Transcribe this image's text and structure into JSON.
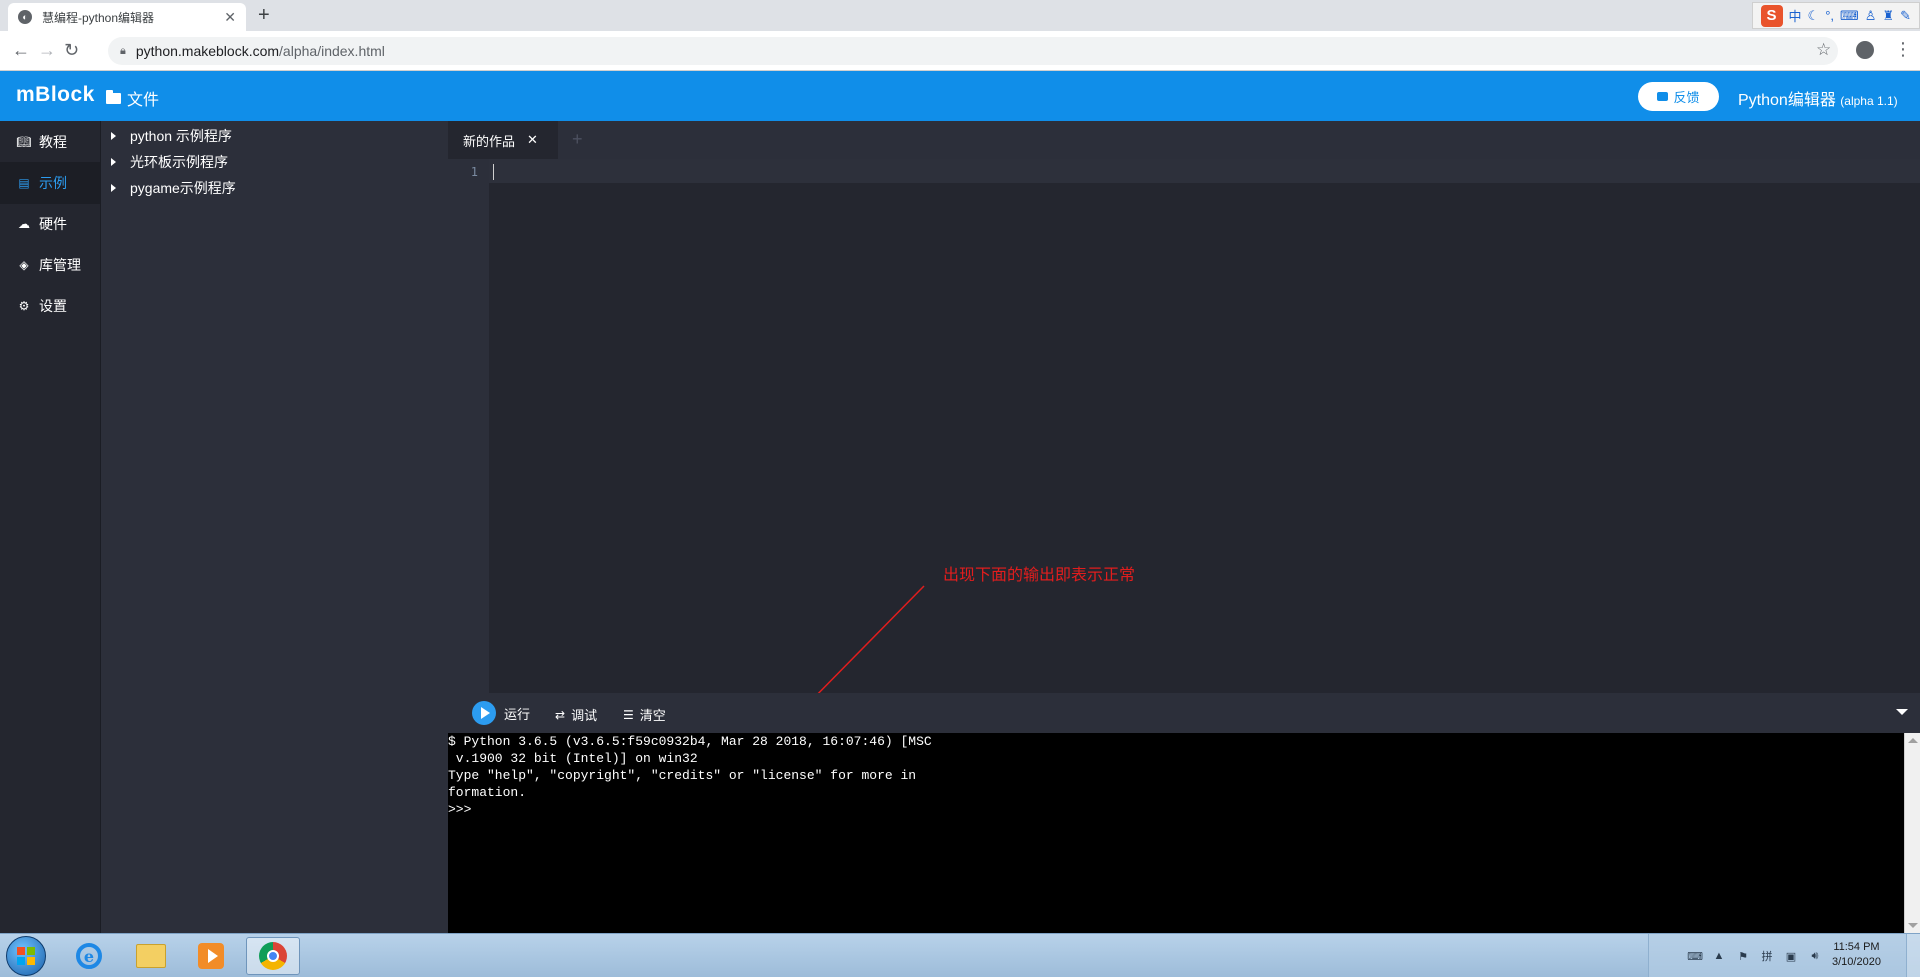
{
  "browser": {
    "tab_title": "慧编程-python编辑器",
    "url_host": "python.makeblock.com",
    "url_path": "/alpha/index.html"
  },
  "ime": {
    "mode": "中"
  },
  "header": {
    "brand": "mBlock",
    "file_menu": "文件",
    "feedback": "反馈",
    "editor_title": "Python编辑器",
    "editor_version": "(alpha 1.1)"
  },
  "leftnav": {
    "items": [
      {
        "label": "教程",
        "icon": "book-icon"
      },
      {
        "label": "示例",
        "icon": "list-icon",
        "active": true
      },
      {
        "label": "硬件",
        "icon": "robot-icon"
      },
      {
        "label": "库管理",
        "icon": "cube-icon"
      },
      {
        "label": "设置",
        "icon": "gear-icon"
      }
    ]
  },
  "examples": {
    "items": [
      {
        "label": "python 示例程序"
      },
      {
        "label": "光环板示例程序"
      },
      {
        "label": "pygame示例程序"
      }
    ]
  },
  "editor": {
    "tab_label": "新的作品",
    "line_numbers": [
      "1"
    ]
  },
  "annotation": {
    "text": "出现下面的输出即表示正常",
    "color": "#e21d1d"
  },
  "runbar": {
    "run": "运行",
    "debug": "调试",
    "clear": "清空"
  },
  "console": {
    "lines": [
      "$ Python 3.6.5 (v3.6.5:f59c0932b4, Mar 28 2018, 16:07:46) [MSC",
      " v.1900 32 bit (Intel)] on win32",
      "Type \"help\", \"copyright\", \"credits\" or \"license\" for more in",
      "formation.",
      ">>>"
    ]
  },
  "taskbar": {
    "time": "11:54 PM",
    "date": "3/10/2020"
  },
  "colors": {
    "accent": "#108ee9",
    "active_nav": "#2c9cf0",
    "editor_bg": "#24262f"
  }
}
